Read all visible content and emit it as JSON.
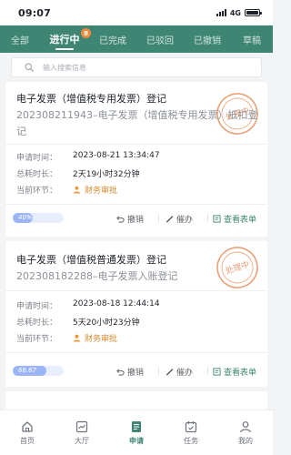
{
  "status_bar": {
    "time": "09:07",
    "network": "4G"
  },
  "tabs": [
    {
      "label": "全部"
    },
    {
      "label": "进行中",
      "badge": "8",
      "active": true
    },
    {
      "label": "已完成"
    },
    {
      "label": "已驳回"
    },
    {
      "label": "已撤销"
    },
    {
      "label": "草稿"
    }
  ],
  "search": {
    "placeholder": "输入搜索信息"
  },
  "cards": [
    {
      "title": "电子发票（增值税专用发票）登记",
      "subtitle": "202308211943–电子发票（增值税专用发票）抵扣登记",
      "apply_time_label": "申请时间：",
      "apply_time": "2023-08-21 13:34:47",
      "duration_label": "总耗时长：",
      "duration": "2天19小时32分钟",
      "node_label": "当前环节：",
      "node": "财务审批",
      "progress_text": "40%",
      "progress_value": 40,
      "stamp_text": "处理中",
      "actions": {
        "cancel": "撤销",
        "urge": "催办",
        "view": "查看表单"
      }
    },
    {
      "title": "电子发票（增值税普通发票）登记",
      "subtitle": "202308182288–电子发票入账登记",
      "apply_time_label": "申请时间：",
      "apply_time": "2023-08-18 12:44:14",
      "duration_label": "总耗时长：",
      "duration": "5天20小时23分钟",
      "node_label": "当前环节：",
      "node": "财务审批",
      "progress_text": "66.67",
      "progress_value": 66.67,
      "stamp_text": "处理中",
      "actions": {
        "cancel": "撤销",
        "urge": "催办",
        "view": "查看表单"
      }
    }
  ],
  "bottom_nav": [
    {
      "label": "首页",
      "icon": "home-icon"
    },
    {
      "label": "大厅",
      "icon": "chart-icon"
    },
    {
      "label": "申请",
      "icon": "document-icon",
      "active": true
    },
    {
      "label": "任务",
      "icon": "calendar-icon"
    },
    {
      "label": "我的",
      "icon": "user-icon"
    }
  ],
  "colors": {
    "brand": "#3f8574",
    "accent_orange": "#d88a2e",
    "badge": "#f08a3c",
    "progress": "#9bb5f6"
  }
}
